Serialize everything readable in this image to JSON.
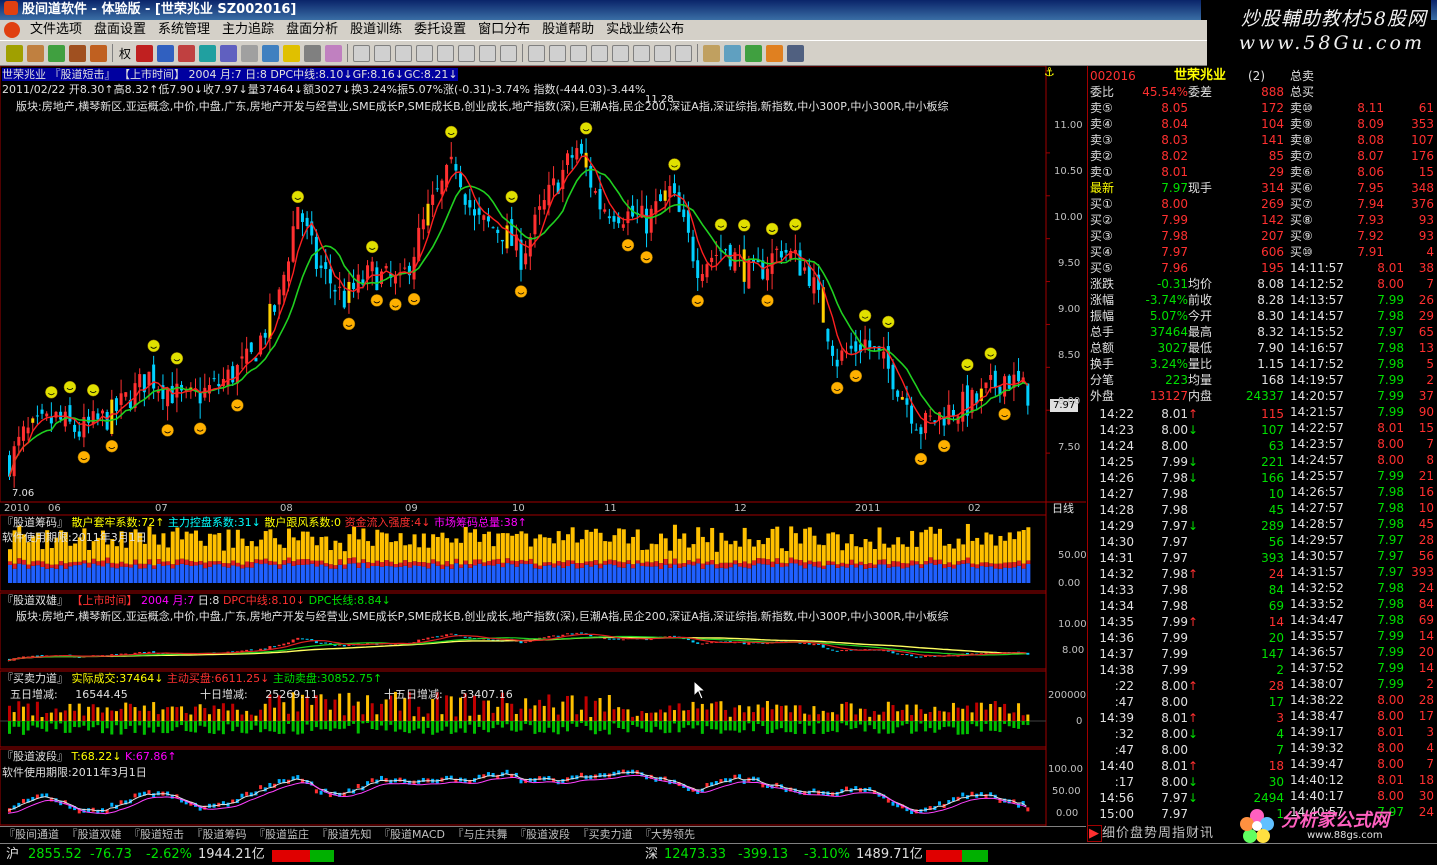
{
  "window": {
    "title": "股间道软件 - 体验版 - [世荣兆业 SZ002016]"
  },
  "watermark": {
    "line1": "炒股輔助教材58股网",
    "line2": "www.58Gu.com"
  },
  "menu": [
    "文件选项",
    "盘面设置",
    "系统管理",
    "主力追踪",
    "盘面分析",
    "股道训练",
    "委托设置",
    "窗口分布",
    "股道帮助",
    "实战业绩公布"
  ],
  "toolbar": {
    "period_label": "权"
  },
  "main_chart": {
    "header": "世荣兆业 『股道短击』 【上市时间】 2004 月:7 日:8 DPC中线:8.10↓GF:8.16↓GC:8.21↓",
    "ohlc_line": "2011/02/22 开8.30↑高8.32↑低7.90↓收7.97↓量37464↓额3027↓换3.24%振5.07%涨(-0.31)-3.74% 指数(-444.03)-3.44%",
    "sector_text": "版块:房地产,横琴新区,亚运概念,中价,中盘,广东,房地产开发与经营业,SME成长P,SME成长B,创业成长,地产指数(深),巨潮A指,民企200,深证A指,深证综指,新指数,中小300P,中小300R,中小板综",
    "peak_label": "11.28",
    "low_label": "7.06",
    "current_tag": "7.97",
    "period": "日线",
    "y_ticks": [
      "11.00",
      "10.50",
      "10.00",
      "9.50",
      "9.00",
      "8.50",
      "8.00",
      "7.50"
    ],
    "x_labels": [
      "2010",
      "06",
      "07",
      "08",
      "09",
      "10",
      "11",
      "12",
      "2011",
      "02"
    ]
  },
  "chart_data": {
    "type": "candlestick",
    "price_range": [
      7.06,
      11.28
    ],
    "last": {
      "date": "2011/02/22",
      "open": 8.3,
      "high": 8.32,
      "low": 7.9,
      "close": 7.97
    },
    "y_ticks": [
      11.0,
      10.5,
      10.0,
      9.5,
      9.0,
      8.5,
      8.0,
      7.5
    ],
    "x_labels": [
      "2010",
      "06",
      "07",
      "08",
      "09",
      "10",
      "11",
      "12",
      "2011",
      "02"
    ]
  },
  "panel_chips": {
    "title": "『股道筹码』",
    "a": "散户套牢系数:72↑",
    "b": "主力控盘系数:31↓",
    "c": "散户跟风系数:0",
    "d": "资金流入强度:4↓",
    "e": "市场筹码总量:38↑",
    "sub": "软件使用期限:2011年3月1日",
    "y_ticks": [
      "50.00",
      "0.00"
    ]
  },
  "panel_shuangxiong": {
    "title": "『股道双雄』",
    "a": "【上市时间】",
    "b": "2004",
    "c": "月:7",
    "d": "日:8",
    "e": "DPC中线:8.10↓",
    "f": "DPC长线:8.84↓",
    "y_ticks": [
      "10.00",
      "8.00"
    ]
  },
  "panel_force": {
    "title": "『买卖力道』",
    "a": "实际成交:37464↓",
    "b": "主动买盘:6611.25↓",
    "c": "主动卖盘:30852.75↑",
    "d_label": "五日增减:",
    "d_val": "16544.45",
    "e_label": "十日增减:",
    "e_val": "25269.11",
    "f_label": "十五日增减:",
    "f_val": "53407.16",
    "y_ticks": [
      "200000",
      "0"
    ]
  },
  "panel_wave": {
    "title": "『股道波段』",
    "a": "T:68.22↓",
    "b": "K:67.86↑",
    "sub": "软件使用期限:2011年3月1日",
    "y_ticks": [
      "100.00",
      "50.00",
      "0.00"
    ]
  },
  "quote": {
    "code": "002016",
    "name": "世荣兆业",
    "suffix": "(2)",
    "ratio_label": "委比",
    "ratio_value": "45.54%",
    "diff_label": "委差",
    "diff_value": "888",
    "sells": [
      {
        "label": "卖⑤",
        "price": "8.05",
        "vol": "172"
      },
      {
        "label": "卖④",
        "price": "8.04",
        "vol": "104"
      },
      {
        "label": "卖③",
        "price": "8.03",
        "vol": "141"
      },
      {
        "label": "卖②",
        "price": "8.02",
        "vol": "85"
      },
      {
        "label": "卖①",
        "price": "8.01",
        "vol": "29"
      }
    ],
    "latest_label": "最新",
    "latest_value": "7.97",
    "hand_label": "现手",
    "hand_value": "314",
    "buys": [
      {
        "label": "买①",
        "price": "8.00",
        "vol": "269"
      },
      {
        "label": "买②",
        "price": "7.99",
        "vol": "142"
      },
      {
        "label": "买③",
        "price": "7.98",
        "vol": "207"
      },
      {
        "label": "买④",
        "price": "7.97",
        "vol": "606"
      },
      {
        "label": "买⑤",
        "price": "7.96",
        "vol": "195"
      }
    ],
    "stats": [
      {
        "l1": "涨跌",
        "v1": "-0.31",
        "l2": "均价",
        "v2": "8.08"
      },
      {
        "l1": "涨幅",
        "v1": "-3.74%",
        "l2": "前收",
        "v2": "8.28"
      },
      {
        "l1": "振幅",
        "v1": "5.07%",
        "l2": "今开",
        "v2": "8.30"
      },
      {
        "l1": "总手",
        "v1": "37464",
        "l2": "最高",
        "v2": "8.32"
      },
      {
        "l1": "总额",
        "v1": "3027",
        "l2": "最低",
        "v2": "7.90"
      },
      {
        "l1": "换手",
        "v1": "3.24%",
        "l2": "量比",
        "v2": "1.15"
      },
      {
        "l1": "分笔",
        "v1": "223",
        "l2": "均量",
        "v2": "168"
      }
    ],
    "outer_label": "外盘",
    "outer_value": "13127",
    "inner_label": "内盘",
    "inner_value": "24337"
  },
  "ticks_left": [
    {
      "t": "14:22",
      "p": "8.01",
      "a": "↑",
      "v": "115"
    },
    {
      "t": "14:23",
      "p": "8.00",
      "a": "↓",
      "v": "107"
    },
    {
      "t": "14:24",
      "p": "8.00",
      "a": "",
      "v": "63"
    },
    {
      "t": "14:25",
      "p": "7.99",
      "a": "↓",
      "v": "221"
    },
    {
      "t": "14:26",
      "p": "7.98",
      "a": "↓",
      "v": "166"
    },
    {
      "t": "14:27",
      "p": "7.98",
      "a": "",
      "v": "10"
    },
    {
      "t": "14:28",
      "p": "7.98",
      "a": "",
      "v": "45"
    },
    {
      "t": "14:29",
      "p": "7.97",
      "a": "↓",
      "v": "289"
    },
    {
      "t": "14:30",
      "p": "7.97",
      "a": "",
      "v": "56"
    },
    {
      "t": "14:31",
      "p": "7.97",
      "a": "",
      "v": "393"
    },
    {
      "t": "14:32",
      "p": "7.98",
      "a": "↑",
      "v": "24"
    },
    {
      "t": "14:33",
      "p": "7.98",
      "a": "",
      "v": "84"
    },
    {
      "t": "14:34",
      "p": "7.98",
      "a": "",
      "v": "69"
    },
    {
      "t": "14:35",
      "p": "7.99",
      "a": "↑",
      "v": "14"
    },
    {
      "t": "14:36",
      "p": "7.99",
      "a": "",
      "v": "20"
    },
    {
      "t": "14:37",
      "p": "7.99",
      "a": "",
      "v": "147"
    },
    {
      "t": "14:38",
      "p": "7.99",
      "a": "",
      "v": "2"
    },
    {
      "t": ":22",
      "p": "8.00",
      "a": "↑",
      "v": "28"
    },
    {
      "t": ":47",
      "p": "8.00",
      "a": "",
      "v": "17"
    },
    {
      "t": "14:39",
      "p": "8.01",
      "a": "↑",
      "v": "3"
    },
    {
      "t": ":32",
      "p": "8.00",
      "a": "↓",
      "v": "4"
    },
    {
      "t": ":47",
      "p": "8.00",
      "a": "",
      "v": "7"
    },
    {
      "t": "14:40",
      "p": "8.01",
      "a": "↑",
      "v": "18"
    },
    {
      "t": ":17",
      "p": "8.00",
      "a": "↓",
      "v": "30"
    },
    {
      "t": "14:56",
      "p": "7.97",
      "a": "↓",
      "v": "2494"
    },
    {
      "t": "15:00",
      "p": "7.97",
      "a": "",
      "v": "1"
    }
  ],
  "right_col": {
    "label_sell": "总卖",
    "label_buy": "总买",
    "sells": [
      {
        "label": "卖⑩",
        "price": "8.11",
        "vol": "61"
      },
      {
        "label": "卖⑨",
        "price": "8.09",
        "vol": "353"
      },
      {
        "label": "卖⑧",
        "price": "8.08",
        "vol": "107"
      },
      {
        "label": "卖⑦",
        "price": "8.07",
        "vol": "176"
      },
      {
        "label": "卖⑥",
        "price": "8.06",
        "vol": "15"
      }
    ],
    "buys": [
      {
        "label": "买⑥",
        "price": "7.95",
        "vol": "348"
      },
      {
        "label": "买⑦",
        "price": "7.94",
        "vol": "376"
      },
      {
        "label": "买⑧",
        "price": "7.93",
        "vol": "93"
      },
      {
        "label": "买⑨",
        "price": "7.92",
        "vol": "93"
      },
      {
        "label": "买⑩",
        "price": "7.91",
        "vol": "4"
      }
    ],
    "ticks": [
      {
        "t": "14:11:57",
        "p": "8.01",
        "v": "38"
      },
      {
        "t": "14:12:52",
        "p": "8.00",
        "v": "7"
      },
      {
        "t": "14:13:57",
        "p": "7.99",
        "v": "26"
      },
      {
        "t": "14:14:57",
        "p": "7.98",
        "v": "29"
      },
      {
        "t": "14:15:52",
        "p": "7.97",
        "v": "65"
      },
      {
        "t": "14:16:57",
        "p": "7.98",
        "v": "13"
      },
      {
        "t": "14:17:52",
        "p": "7.98",
        "v": "5"
      },
      {
        "t": "14:19:57",
        "p": "7.99",
        "v": "2"
      },
      {
        "t": "14:20:57",
        "p": "7.99",
        "v": "37"
      },
      {
        "t": "14:21:57",
        "p": "7.99",
        "v": "90"
      },
      {
        "t": "14:22:57",
        "p": "8.01",
        "v": "15"
      },
      {
        "t": "14:23:57",
        "p": "8.00",
        "v": "7"
      },
      {
        "t": "14:24:57",
        "p": "8.00",
        "v": "8"
      },
      {
        "t": "14:25:57",
        "p": "7.99",
        "v": "21"
      },
      {
        "t": "14:26:57",
        "p": "7.98",
        "v": "16"
      },
      {
        "t": "14:27:57",
        "p": "7.98",
        "v": "10"
      },
      {
        "t": "14:28:57",
        "p": "7.98",
        "v": "45"
      },
      {
        "t": "14:29:57",
        "p": "7.97",
        "v": "28"
      },
      {
        "t": "14:30:57",
        "p": "7.97",
        "v": "56"
      },
      {
        "t": "14:31:57",
        "p": "7.97",
        "v": "393"
      },
      {
        "t": "14:32:52",
        "p": "7.98",
        "v": "24"
      },
      {
        "t": "14:33:52",
        "p": "7.98",
        "v": "84"
      },
      {
        "t": "14:34:47",
        "p": "7.98",
        "v": "69"
      },
      {
        "t": "14:35:57",
        "p": "7.99",
        "v": "14"
      },
      {
        "t": "14:36:57",
        "p": "7.99",
        "v": "20"
      },
      {
        "t": "14:37:52",
        "p": "7.99",
        "v": "14"
      },
      {
        "t": "14:38:07",
        "p": "7.99",
        "v": "2"
      },
      {
        "t": "14:38:22",
        "p": "8.00",
        "v": "28"
      },
      {
        "t": "14:38:47",
        "p": "8.00",
        "v": "17"
      },
      {
        "t": "14:39:17",
        "p": "8.01",
        "v": "3"
      },
      {
        "t": "14:39:32",
        "p": "8.00",
        "v": "4"
      },
      {
        "t": "14:39:47",
        "p": "8.00",
        "v": "7"
      },
      {
        "t": "14:40:12",
        "p": "8.01",
        "v": "18"
      },
      {
        "t": "14:40:17",
        "p": "8.00",
        "v": "30"
      },
      {
        "t": "14:40:57",
        "p": "7.97",
        "v": "24"
      }
    ]
  },
  "tabs": [
    "『股间通道",
    "『股道双雄",
    "『股道短击",
    "『股道筹码",
    "『股道监庄",
    "『股道先知",
    "『股道MACD",
    "『与庄共舞",
    "『股道波段",
    "『买卖力道",
    "『大势领先"
  ],
  "right_tabs": "细价盘势周指财讯",
  "status": {
    "sh_label": "沪",
    "sh_index": "2855.52",
    "sh_change": "-76.73",
    "sh_pct": "-2.62%",
    "sh_amount": "1944.21亿",
    "sz_label": "深",
    "sz_index": "12473.33",
    "sz_change": "-399.13",
    "sz_pct": "-3.10%",
    "sz_amount": "1489.71亿"
  },
  "logo88": {
    "text": "分析家公式网",
    "url": "www.88gs.com"
  },
  "colors": {
    "up": "#ff3030",
    "down": "#00d0ff",
    "ma_short": "#ff2020",
    "ma_long": "#20d020",
    "accent": "#ffff00",
    "panel_border": "#a00000"
  }
}
